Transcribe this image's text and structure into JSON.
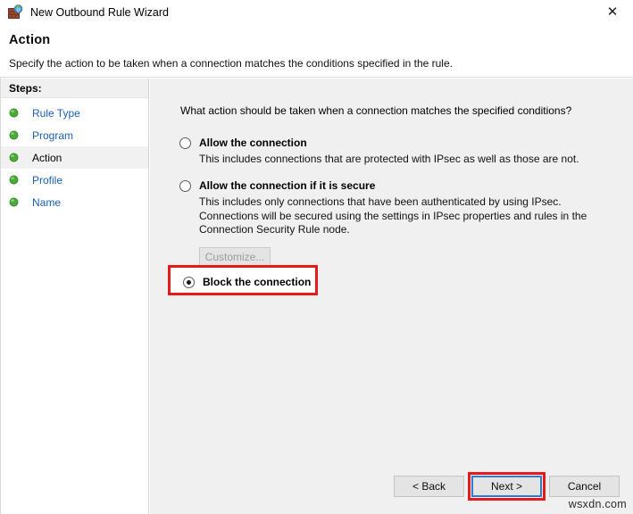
{
  "window": {
    "title": "New Outbound Rule Wizard",
    "icon": "firewall-globe-icon",
    "close_label": "✕"
  },
  "header": {
    "title": "Action",
    "subtitle": "Specify the action to be taken when a connection matches the conditions specified in the rule."
  },
  "sidebar": {
    "header": "Steps:",
    "items": [
      {
        "label": "Rule Type",
        "current": false
      },
      {
        "label": "Program",
        "current": false
      },
      {
        "label": "Action",
        "current": true
      },
      {
        "label": "Profile",
        "current": false
      },
      {
        "label": "Name",
        "current": false
      }
    ]
  },
  "main": {
    "question": "What action should be taken when a connection matches the specified conditions?",
    "options": [
      {
        "title": "Allow the connection",
        "description": "This includes connections that are protected with IPsec as well as those are not.",
        "selected": false
      },
      {
        "title": "Allow the connection if it is secure",
        "description": "This includes only connections that have been authenticated by using IPsec.  Connections will be secured using the settings in IPsec properties and rules in the Connection Security Rule node.",
        "selected": false,
        "customize_label": "Customize..."
      },
      {
        "title": "Block the connection",
        "description": "",
        "selected": true
      }
    ]
  },
  "footer": {
    "back_label": "< Back",
    "next_label": "Next >",
    "cancel_label": "Cancel"
  },
  "watermark": "wsxdn.com",
  "colors": {
    "highlight_red": "#e8191b",
    "focus_blue": "#2b7cd3",
    "link_blue": "#1a5fb4",
    "pane_gray": "#f0f0f0",
    "bullet_green": "#4aab38"
  }
}
